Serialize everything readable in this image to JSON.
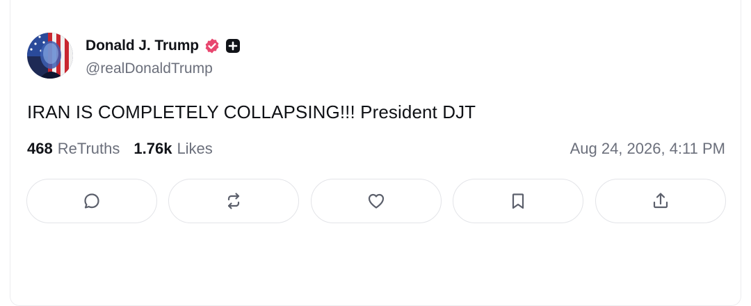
{
  "post": {
    "author": {
      "display_name": "Donald J. Trump",
      "handle": "@realDonaldTrump",
      "verified_badge_icon": "verified-check-icon",
      "verified_badge_color": "#e8476f",
      "plus_badge_icon": "plus-badge-icon"
    },
    "text": "IRAN IS COMPLETELY COLLAPSING!!! President DJT",
    "stats": {
      "retruths_count": "468",
      "retruths_label": "ReTruths",
      "likes_count": "1.76k",
      "likes_label": "Likes"
    },
    "timestamp": "Aug 24, 2026, 4:11 PM"
  },
  "actions": [
    {
      "name": "reply",
      "icon": "comment-icon"
    },
    {
      "name": "retruth",
      "icon": "repost-icon"
    },
    {
      "name": "like",
      "icon": "heart-icon"
    },
    {
      "name": "bookmark",
      "icon": "bookmark-icon"
    },
    {
      "name": "share",
      "icon": "share-icon"
    }
  ],
  "colors": {
    "text_primary": "#111318",
    "text_secondary": "#6b6f7b",
    "border": "#e3e4e8",
    "icon": "#5b5f6b"
  }
}
